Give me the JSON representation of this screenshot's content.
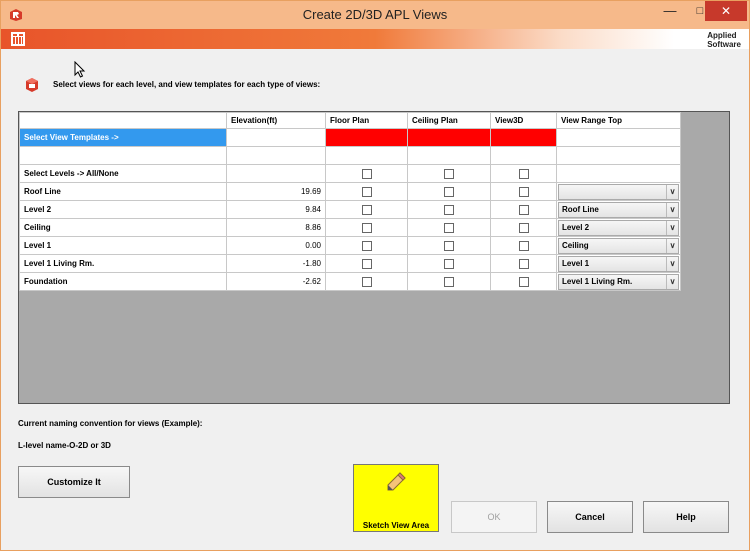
{
  "window": {
    "title": "Create 2D/3D APL Views",
    "minimize": "—",
    "maximize": "□",
    "close": "✕"
  },
  "brand": {
    "line1": "Applied",
    "line2": "Software"
  },
  "instruction": "Select views for each level, and view templates for each type of views:",
  "grid": {
    "headers": [
      "",
      "Elevation(ft)",
      "Floor Plan",
      "Ceiling Plan",
      "View3D",
      "View Range Top"
    ],
    "template_row_label": "Select View Templates ->",
    "all_none_label": "Select Levels -> All/None",
    "rows": [
      {
        "name": "Roof Line",
        "elevation": "19.69",
        "view_range_top": ""
      },
      {
        "name": "Level 2",
        "elevation": "9.84",
        "view_range_top": "Roof Line"
      },
      {
        "name": "Ceiling",
        "elevation": "8.86",
        "view_range_top": "Level 2"
      },
      {
        "name": "Level 1",
        "elevation": "0.00",
        "view_range_top": "Ceiling"
      },
      {
        "name": "Level 1 Living Rm.",
        "elevation": "-1.80",
        "view_range_top": "Level 1"
      },
      {
        "name": "Foundation",
        "elevation": "-2.62",
        "view_range_top": "Level 1 Living Rm."
      }
    ]
  },
  "naming": {
    "label": "Current naming convention for views (Example):",
    "value": "L-level name-O-2D or 3D"
  },
  "buttons": {
    "customize": "Customize It",
    "sketch": "Sketch View Area",
    "ok": "OK",
    "cancel": "Cancel",
    "help": "Help"
  },
  "colors": {
    "template_header": "#3399ee",
    "template_cell": "#ff0000",
    "sketch_button": "#ffff00",
    "close_button": "#c7392b"
  },
  "icons": [
    "revit-app-icon",
    "grid-app-icon",
    "views-icon",
    "mouse-cursor-icon",
    "pencil-icon",
    "chevron-down-icon",
    "checkbox-icon"
  ]
}
